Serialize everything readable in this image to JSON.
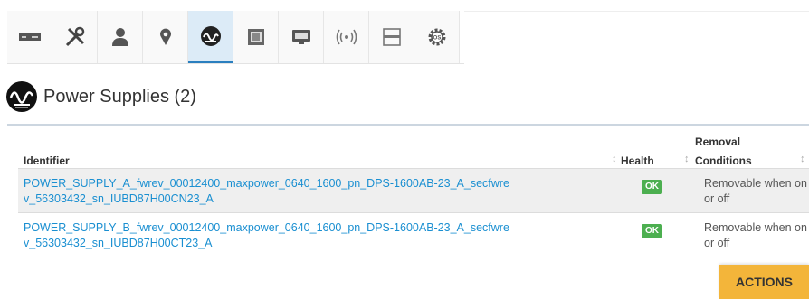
{
  "tabs": [
    {
      "icon": "server-chassis-icon"
    },
    {
      "icon": "tools-icon"
    },
    {
      "icon": "user-icon"
    },
    {
      "icon": "location-pin-icon"
    },
    {
      "icon": "power-supply-icon",
      "active": true
    },
    {
      "icon": "processor-icon"
    },
    {
      "icon": "monitor-icon"
    },
    {
      "icon": "wireless-icon"
    },
    {
      "icon": "drive-bay-icon"
    },
    {
      "icon": "os-gear-icon"
    }
  ],
  "section": {
    "title": "Power Supplies (2)"
  },
  "table": {
    "headers": {
      "identifier": "Identifier",
      "health": "Health",
      "removal_line1": "Removal",
      "removal_line2": "Conditions"
    },
    "rows": [
      {
        "identifier": "POWER_SUPPLY_A_fwrev_00012400_maxpower_0640_1600_pn_DPS-1600AB-23_A_secfwrev_56303432_sn_IUBD87H00CN23_A",
        "health": "OK",
        "removal": "Removable when on or off"
      },
      {
        "identifier": "POWER_SUPPLY_B_fwrev_00012400_maxpower_0640_1600_pn_DPS-1600AB-23_A_secfwrev_56303432_sn_IUBD87H00CT23_A",
        "health": "OK",
        "removal": "Removable when on or off"
      }
    ]
  },
  "actions_label": "ACTIONS",
  "colors": {
    "link": "#1a8fd1",
    "ok": "#4caf50",
    "actions": "#f3b53a",
    "active_tab": "#dcebf7"
  }
}
